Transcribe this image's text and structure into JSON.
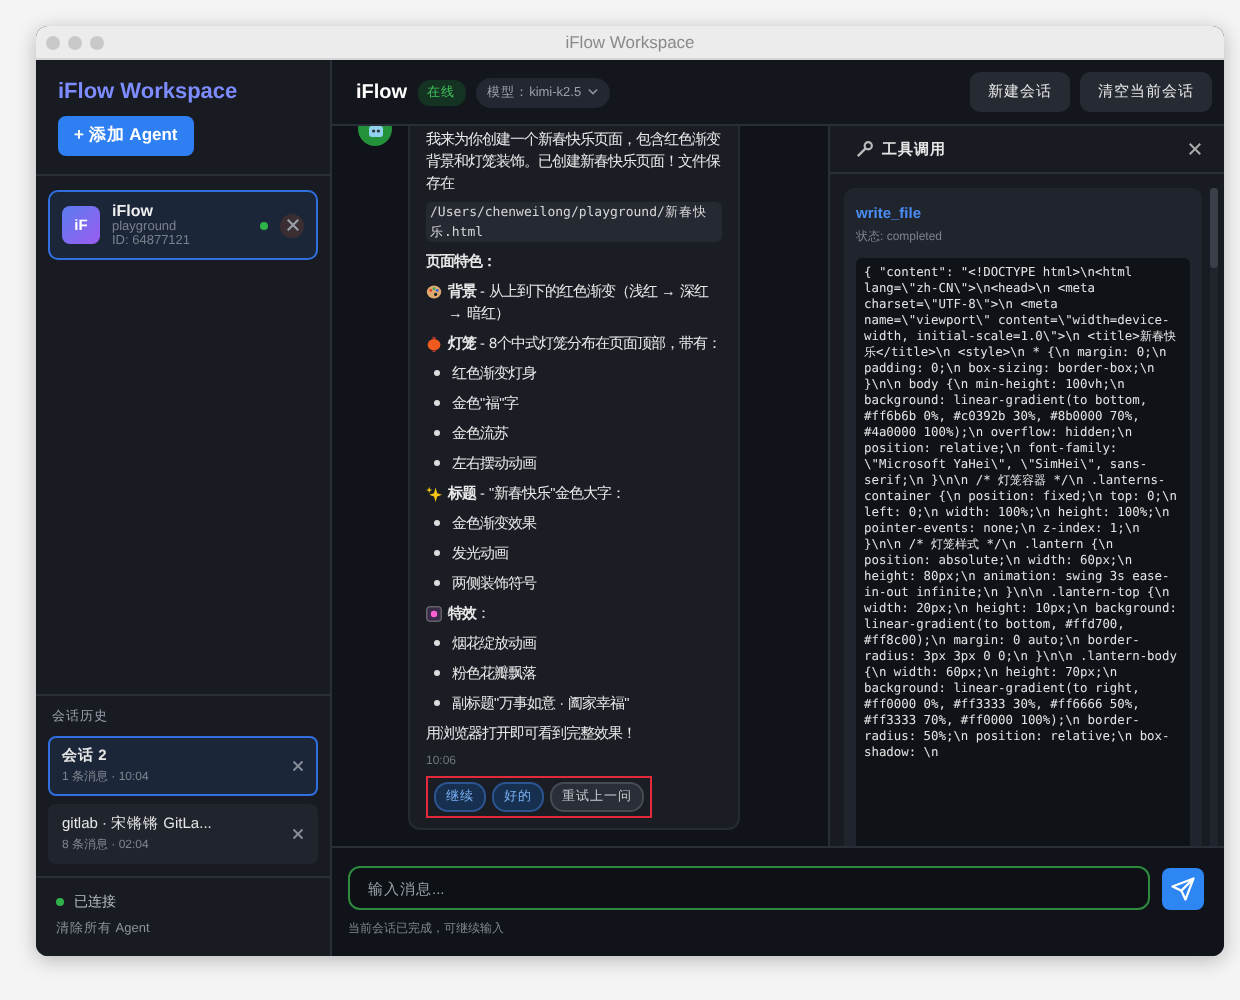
{
  "window": {
    "title": "iFlow Workspace"
  },
  "sidebar": {
    "title": "iFlow Workspace",
    "add_button": "+ 添加 Agent",
    "agents": [
      {
        "avatar": "iF",
        "name": "iFlow",
        "workspace": "playground",
        "id": "ID: 64877121",
        "selected": true,
        "online": true
      }
    ],
    "history_label": "会话历史",
    "sessions": [
      {
        "title": "会话 2",
        "meta": "1 条消息 · 10:04",
        "selected": true
      },
      {
        "title": "gitlab · 宋锵锵 GitLa...",
        "meta": "8 条消息 · 02:04",
        "selected": false
      }
    ],
    "status": {
      "label": "已连接",
      "connected": true
    },
    "clear_link": "清除所有 Agent"
  },
  "header": {
    "title": "iFlow",
    "badge": "在线",
    "model": "模型：kimi-k2.5",
    "buttons": [
      "新建会话",
      "清空当前会话"
    ]
  },
  "message": {
    "lines": [
      {
        "kind": "text",
        "text": "我来为你创建一个新春快乐页面，包含红色渐变背景和灯笼装饰。已创建新春快乐页面！文件保存在"
      },
      {
        "kind": "path",
        "text": "/Users/chenweilong/playground/新春快乐.html"
      },
      {
        "kind": "heading",
        "text": "页面特色："
      },
      {
        "kind": "feature",
        "text": "**背景** - 从上到下的红色渐变（浅红 → 深红 → 暗红）"
      },
      {
        "kind": "feature",
        "text": "**灯笼** - 8个中式灯笼分布在页面顶部，带有："
      },
      {
        "kind": "bullet",
        "text": "红色渐变灯身"
      },
      {
        "kind": "bullet",
        "text": "金色\"福\"字"
      },
      {
        "kind": "bullet",
        "text": "金色流苏"
      },
      {
        "kind": "bullet",
        "text": "左右摆动动画"
      },
      {
        "kind": "feature",
        "text": "**标题** - \"新春快乐\"金色大字："
      },
      {
        "kind": "bullet",
        "text": "金色渐变效果"
      },
      {
        "kind": "bullet",
        "text": "发光动画"
      },
      {
        "kind": "bullet",
        "text": "两侧装饰符号"
      },
      {
        "kind": "feature",
        "text": "**特效**："
      },
      {
        "kind": "bullet",
        "text": "烟花绽放动画"
      },
      {
        "kind": "bullet",
        "text": "粉色花瓣飘落"
      },
      {
        "kind": "bullet",
        "text": "副标题\"万事如意 · 阖家幸福\""
      },
      {
        "kind": "text",
        "text": "用浏览器打开即可看到完整效果！"
      }
    ],
    "time": "10:06",
    "quick_replies": [
      {
        "label": "继续",
        "kind": "primary"
      },
      {
        "label": "好的",
        "kind": "primary"
      },
      {
        "label": "重试上一问",
        "kind": "secondary"
      }
    ]
  },
  "input": {
    "placeholder": "输入消息...",
    "hint": "当前会话已完成，可继续输入"
  },
  "tool_panel": {
    "title": "工具调用",
    "tool": "write_file",
    "status": "状态: completed",
    "code": "{ \"content\": \"<!DOCTYPE html>\\n<html lang=\\\"zh-CN\\\">\\n<head>\\n <meta charset=\\\"UTF-8\\\">\\n <meta name=\\\"viewport\\\" content=\\\"width=device-width, initial-scale=1.0\\\">\\n <title>新春快乐</title>\\n <style>\\n * {\\n margin: 0;\\n padding: 0;\\n box-sizing: border-box;\\n }\\n\\n body {\\n min-height: 100vh;\\n background: linear-gradient(to bottom, #ff6b6b 0%, #c0392b 30%, #8b0000 70%, #4a0000 100%);\\n overflow: hidden;\\n position: relative;\\n font-family: \\\"Microsoft YaHei\\\", \\\"SimHei\\\", sans-serif;\\n }\\n\\n /* 灯笼容器 */\\n .lanterns-container {\\n position: fixed;\\n top: 0;\\n left: 0;\\n width: 100%;\\n height: 100%;\\n pointer-events: none;\\n z-index: 1;\\n }\\n\\n /* 灯笼样式 */\\n .lantern {\\n position: absolute;\\n width: 60px;\\n height: 80px;\\n animation: swing 3s ease-in-out infinite;\\n }\\n\\n .lantern-top {\\n width: 20px;\\n height: 10px;\\n background: linear-gradient(to bottom, #ffd700, #ff8c00);\\n margin: 0 auto;\\n border-radius: 3px 3px 0 0;\\n }\\n\\n .lantern-body {\\n width: 60px;\\n height: 70px;\\n background: linear-gradient(to right, #ff0000 0%, #ff3333 30%, #ff6666 50%, #ff3333 70%, #ff0000 100%);\\n border-radius: 50%;\\n position: relative;\\n box-shadow: \\n"
  }
}
